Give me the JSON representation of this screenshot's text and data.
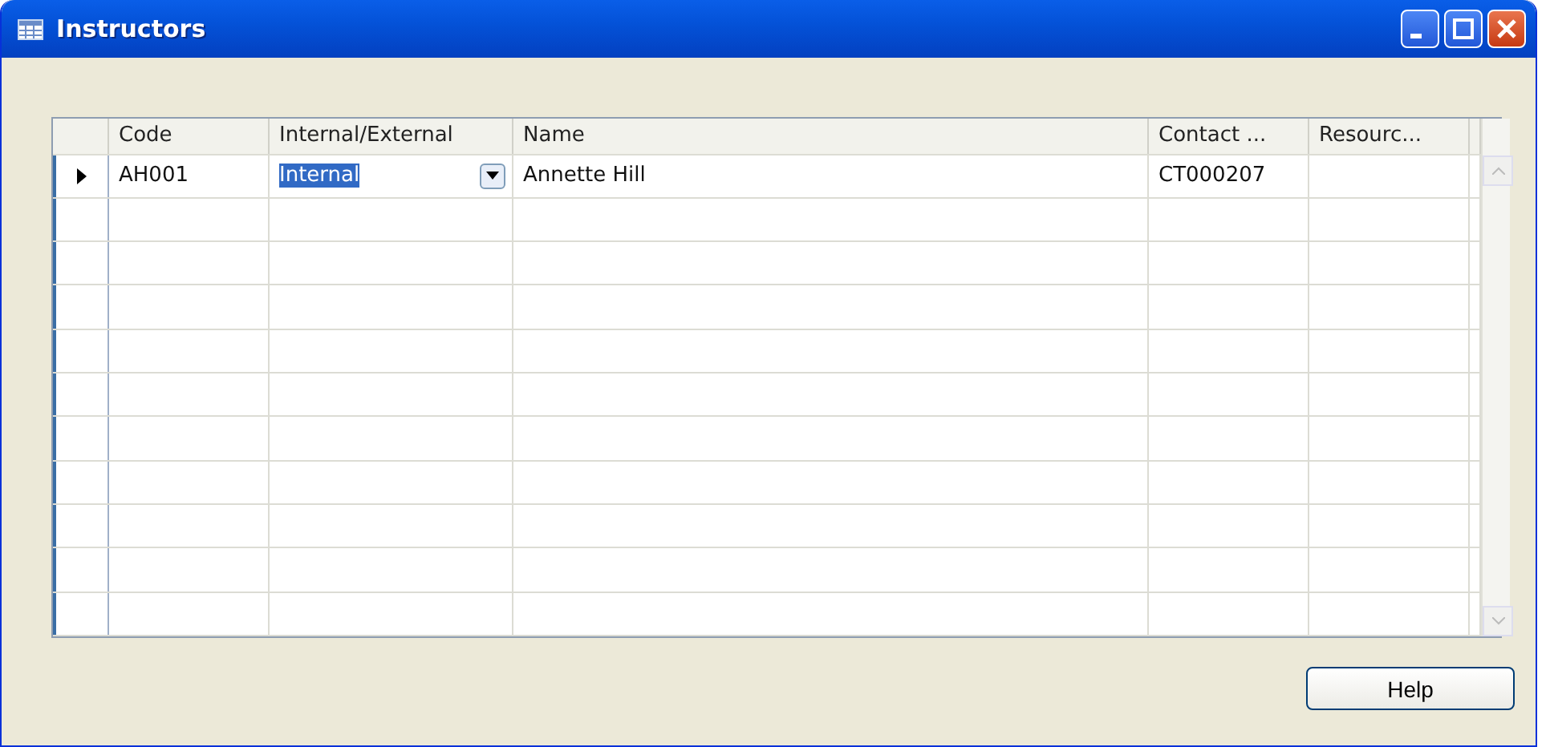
{
  "window": {
    "title": "Instructors"
  },
  "table": {
    "columns": [
      "Code",
      "Internal/External",
      "Name",
      "Contact ...",
      "Resourc..."
    ],
    "rows": [
      {
        "current": true,
        "cells": [
          "AH001",
          "Internal",
          "Annette Hill",
          "CT000207"
        ],
        "editing": true
      }
    ]
  },
  "buttons": [
    "Help"
  ]
}
